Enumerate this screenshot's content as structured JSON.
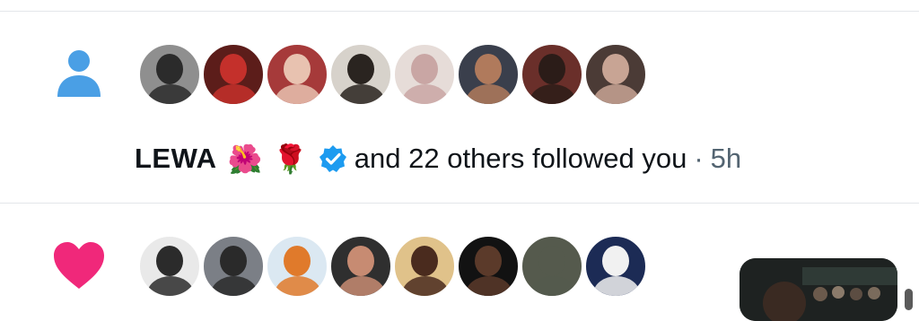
{
  "notifications": [
    {
      "type": "follow",
      "icon": "person-icon",
      "accent": "#4a9fe5",
      "avatars": [
        {
          "label": "follower-1",
          "bg": "#8f8f8f",
          "fg": "#2b2b2b"
        },
        {
          "label": "follower-2",
          "bg": "#5c1d1a",
          "fg": "#c4302b"
        },
        {
          "label": "follower-3",
          "bg": "#a63a3a",
          "fg": "#e8c2b0"
        },
        {
          "label": "follower-4",
          "bg": "#d7d2cb",
          "fg": "#2a2420"
        },
        {
          "label": "follower-5",
          "bg": "#e6dcd8",
          "fg": "#c9a6a4"
        },
        {
          "label": "follower-6",
          "bg": "#3a3f4c",
          "fg": "#b07a5c"
        },
        {
          "label": "follower-7",
          "bg": "#6a2f2a",
          "fg": "#2b1c18"
        },
        {
          "label": "follower-8",
          "bg": "#4b3b36",
          "fg": "#c8a494"
        }
      ],
      "name": "LEWA",
      "emojis": [
        "🌺",
        "🌹"
      ],
      "verified": true,
      "text": "and 22 others followed you",
      "separator": "·",
      "time": "5h"
    },
    {
      "type": "like",
      "icon": "heart-icon",
      "accent": "#f0287a",
      "avatars": [
        {
          "label": "liker-1",
          "bg": "#e9e9e9",
          "fg": "#2b2b2b"
        },
        {
          "label": "liker-2",
          "bg": "#7b7f86",
          "fg": "#2a2a2a"
        },
        {
          "label": "liker-3",
          "bg": "#dbe8f2",
          "fg": "#e07a2b"
        },
        {
          "label": "liker-4",
          "bg": "#2f2f2f",
          "fg": "#c78b72"
        },
        {
          "label": "liker-5",
          "bg": "#e0c28a",
          "fg": "#4a2b1e"
        },
        {
          "label": "liker-6",
          "bg": "#121212",
          "fg": "#5b3a2a"
        },
        {
          "label": "liker-7",
          "bg": "#555a4d",
          "fg": "#555a4d"
        },
        {
          "label": "liker-8",
          "bg": "#1c2b55",
          "fg": "#f1f1f1"
        }
      ]
    }
  ]
}
